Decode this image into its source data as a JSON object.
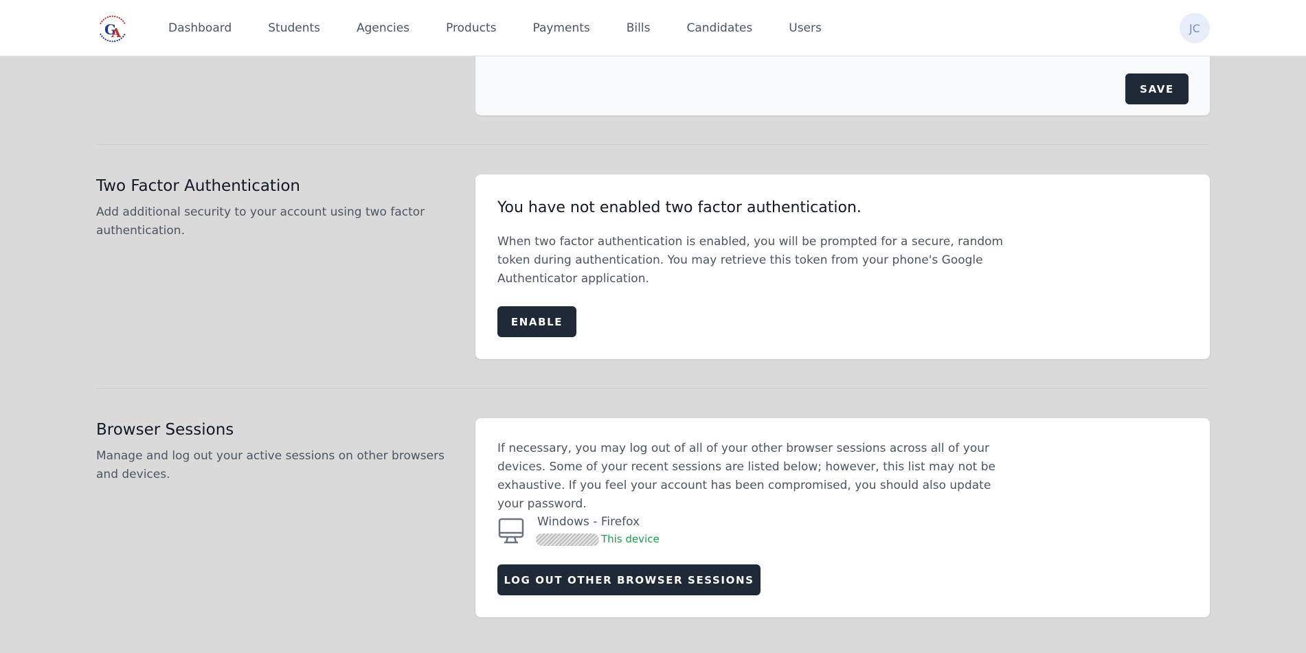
{
  "nav": {
    "logo_alt": "GA",
    "links": [
      {
        "label": "Dashboard"
      },
      {
        "label": "Students"
      },
      {
        "label": "Agencies"
      },
      {
        "label": "Products"
      },
      {
        "label": "Payments"
      },
      {
        "label": "Bills"
      },
      {
        "label": "Candidates"
      },
      {
        "label": "Users"
      }
    ],
    "avatar_initials": "JC"
  },
  "profile_footer": {
    "save_label": "SAVE"
  },
  "two_factor": {
    "title": "Two Factor Authentication",
    "description": "Add additional security to your account using two factor authentication.",
    "status_heading": "You have not enabled two factor authentication.",
    "body": "When two factor authentication is enabled, you will be prompted for a secure, random token during authentication. You may retrieve this token from your phone's Google Authenticator application.",
    "enable_label": "ENABLE"
  },
  "sessions": {
    "title": "Browser Sessions",
    "description": "Manage and log out your active sessions on other browsers and devices.",
    "body": "If necessary, you may log out of all of your other browser sessions across all of your devices. Some of your recent sessions are listed below; however, this list may not be exhaustive. If you feel your account has been compromised, you should also update your password.",
    "items": [
      {
        "platform": "Windows - Firefox",
        "current_label": "This device",
        "icon": "monitor-icon"
      }
    ],
    "logout_label": "LOG OUT OTHER BROWSER SESSIONS"
  },
  "colors": {
    "background": "#dadada",
    "button": "#1f2937",
    "current_device": "#16a34a"
  }
}
